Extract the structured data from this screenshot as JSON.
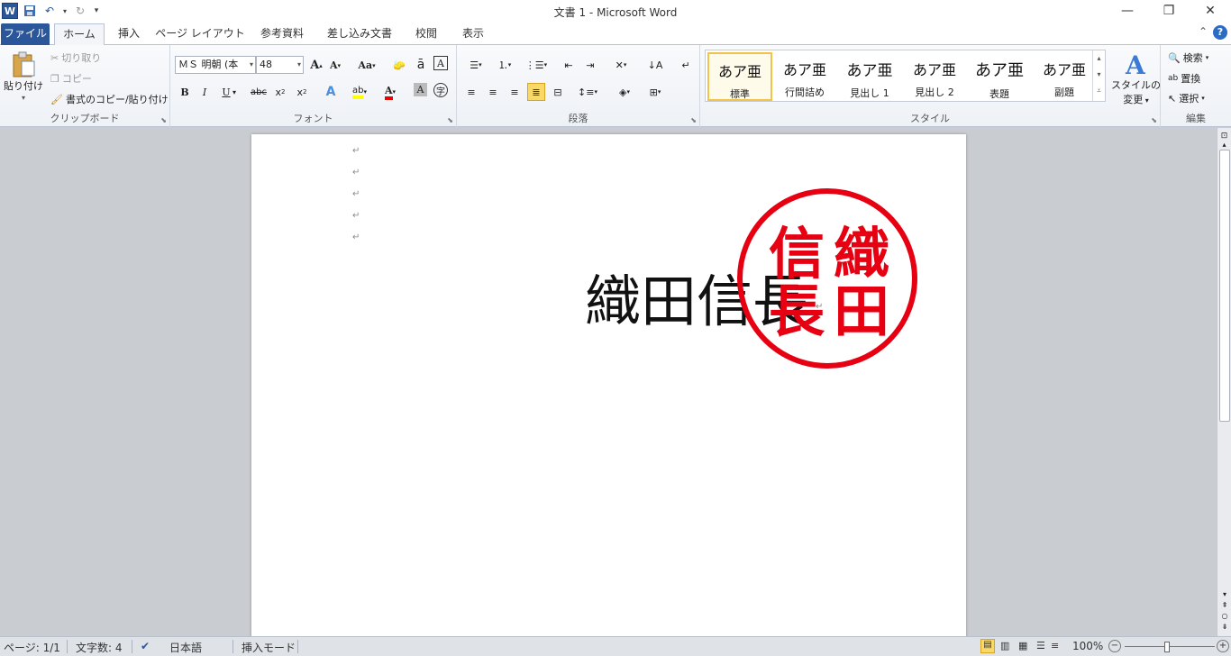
{
  "window": {
    "title": "文書 1 - Microsoft Word"
  },
  "qat": {
    "app_icon": "W",
    "save": "save-icon",
    "undo": "undo-icon",
    "redo": "redo-icon",
    "customize": "customize-qat-icon"
  },
  "tabs": {
    "file": "ファイル",
    "home": "ホーム",
    "insert": "挿入",
    "page_layout": "ページ レイアウト",
    "references": "参考資料",
    "mailings": "差し込み文書",
    "review": "校閲",
    "view": "表示"
  },
  "clipboard": {
    "paste": "貼り付け",
    "cut": "切り取り",
    "copy": "コピー",
    "format_painter": "書式のコピー/貼り付け",
    "label": "クリップボード"
  },
  "font": {
    "name": "ＭＳ 明朝 (本",
    "size": "48",
    "label": "フォント"
  },
  "paragraph": {
    "label": "段落"
  },
  "styles": {
    "preview": "あア亜",
    "items": [
      "標準",
      "行間詰め",
      "見出し 1",
      "見出し 2",
      "表題",
      "副題"
    ],
    "change_styles": "スタイルの",
    "change_styles2": "変更",
    "label": "スタイル"
  },
  "editing": {
    "find": "検索",
    "replace": "置換",
    "select": "選択",
    "label": "編集"
  },
  "document": {
    "body_text": "織田信長",
    "seal_chars": [
      "織",
      "田",
      "信",
      "長"
    ]
  },
  "status": {
    "page": "ページ: 1/1",
    "word_count": "文字数: 4",
    "language": "日本語",
    "mode": "挿入モード",
    "zoom": "100%"
  },
  "colors": {
    "accent": "#2b579a",
    "seal": "#e60012"
  }
}
